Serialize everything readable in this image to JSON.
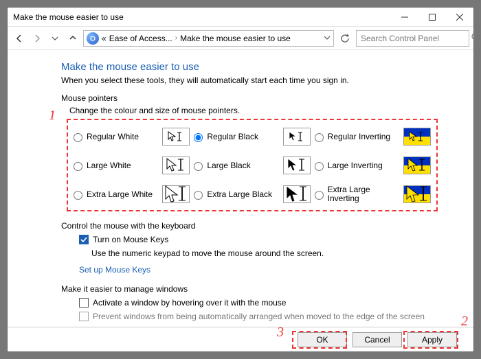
{
  "window": {
    "title": "Make the mouse easier to use"
  },
  "breadcrumb": {
    "lead": "«",
    "item1": "Ease of Access...",
    "item2": "Make the mouse easier to use"
  },
  "search": {
    "placeholder": "Search Control Panel"
  },
  "page": {
    "heading": "Make the mouse easier to use",
    "subheading": "When you select these tools, they will automatically start each time you sign in."
  },
  "pointers": {
    "title": "Mouse pointers",
    "desc": "Change the colour and size of mouse pointers.",
    "selected": "regular_black",
    "options": {
      "regular_white": "Regular White",
      "regular_black": "Regular Black",
      "regular_inverting": "Regular Inverting",
      "large_white": "Large White",
      "large_black": "Large Black",
      "large_inverting": "Large Inverting",
      "xl_white": "Extra Large White",
      "xl_black": "Extra Large Black",
      "xl_inverting": "Extra Large Inverting"
    }
  },
  "keyboard": {
    "title": "Control the mouse with the keyboard",
    "mousekeys_label": "Turn on Mouse Keys",
    "mousekeys_checked": true,
    "mousekeys_desc": "Use the numeric keypad to move the mouse around the screen.",
    "setup_link": "Set up Mouse Keys"
  },
  "windows": {
    "title": "Make it easier to manage windows",
    "hover_label": "Activate a window by hovering over it with the mouse",
    "hover_checked": false,
    "snap_label": "Prevent windows from being automatically arranged when moved to the edge of the screen",
    "snap_checked": false
  },
  "footer": {
    "ok": "OK",
    "cancel": "Cancel",
    "apply": "Apply"
  },
  "annotations": {
    "n1": "1",
    "n2": "2",
    "n3": "3"
  }
}
